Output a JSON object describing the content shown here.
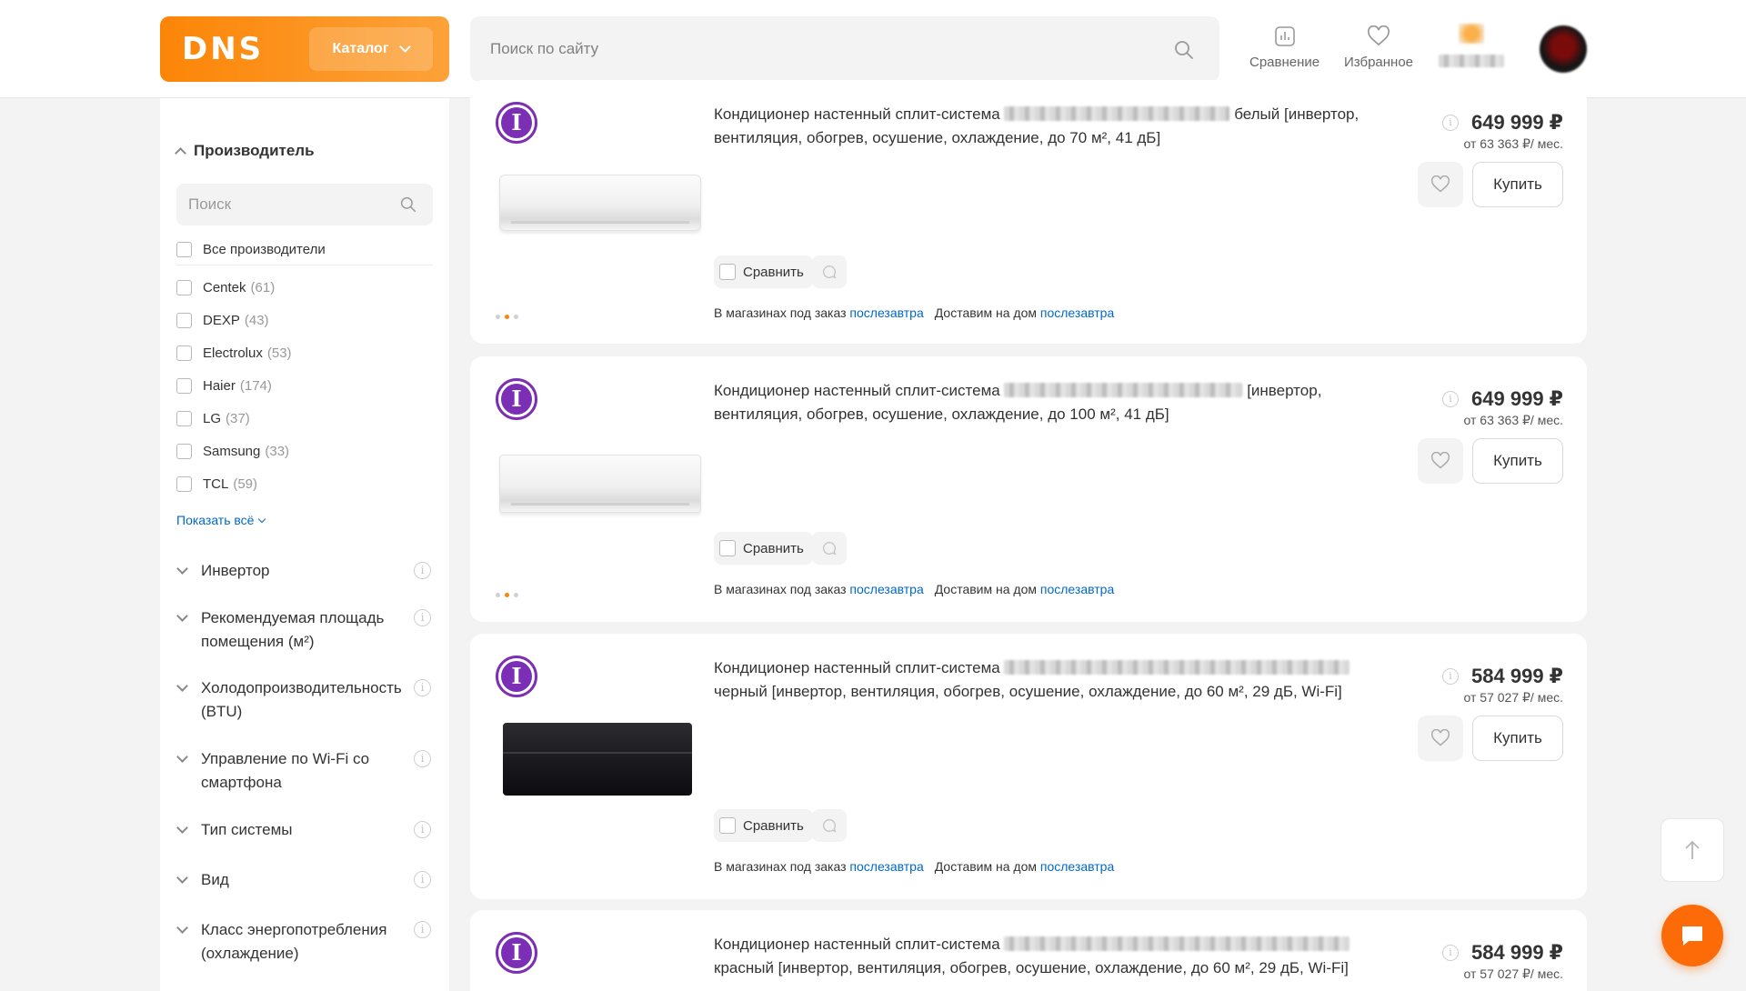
{
  "header": {
    "logo": "DNS",
    "catalog_label": "Каталог",
    "search_placeholder": "Поиск по сайту",
    "compare_label": "Сравнение",
    "favorites_label": "Избранное",
    "brand_color": "#fc8507"
  },
  "filters": {
    "manufacturer": {
      "title": "Производитель",
      "search_placeholder": "Поиск",
      "all_label": "Все производители",
      "items": [
        {
          "name": "Centek",
          "count": "(61)"
        },
        {
          "name": "DEXP",
          "count": "(43)"
        },
        {
          "name": "Electrolux",
          "count": "(53)"
        },
        {
          "name": "Haier",
          "count": "(174)"
        },
        {
          "name": "LG",
          "count": "(37)"
        },
        {
          "name": "Samsung",
          "count": "(33)"
        },
        {
          "name": "TCL",
          "count": "(59)"
        }
      ],
      "show_all": "Показать всё"
    },
    "sections": [
      "Инвертор",
      "Рекомендуемая площадь помещения (м²)",
      "Холодопроизводительность (BTU)",
      "Управление по Wi-Fi со смартфона",
      "Тип системы",
      "Вид",
      "Класс энергопотребления (охлаждение)"
    ]
  },
  "products": [
    {
      "badge": "I",
      "title_prefix": "Кондиционер настенный сплит-система",
      "title_after_blur": "белый [инвертор,",
      "title_line2": "вентиляция, обогрев, осушение, охлаждение, до 70 м², 41 дБ]",
      "price": "649 999 ₽",
      "credit": "от 63 363 ₽/ мес.",
      "compare": "Сравнить",
      "buy": "Купить",
      "avail_store": "В магазинах под заказ",
      "avail_store_date": "послезавтра",
      "avail_delivery": "Доставим на дом",
      "avail_delivery_date": "послезавтра",
      "unit_color": "white"
    },
    {
      "badge": "I",
      "title_prefix": "Кондиционер настенный сплит-система",
      "title_after_blur": "[инвертор,",
      "title_line2": "вентиляция, обогрев, осушение, охлаждение, до 100 м², 41 дБ]",
      "price": "649 999 ₽",
      "credit": "от 63 363 ₽/ мес.",
      "compare": "Сравнить",
      "buy": "Купить",
      "avail_store": "В магазинах под заказ",
      "avail_store_date": "послезавтра",
      "avail_delivery": "Доставим на дом",
      "avail_delivery_date": "послезавтра",
      "unit_color": "white"
    },
    {
      "badge": "I",
      "title_prefix": "Кондиционер настенный сплит-система",
      "title_after_blur": "",
      "title_line2": "черный [инвертор, вентиляция, обогрев, осушение, охлаждение, до 60 м², 29 дБ, Wi-Fi]",
      "price": "584 999 ₽",
      "credit": "от 57 027 ₽/ мес.",
      "compare": "Сравнить",
      "buy": "Купить",
      "avail_store": "В магазинах под заказ",
      "avail_store_date": "послезавтра",
      "avail_delivery": "Доставим на дом",
      "avail_delivery_date": "послезавтра",
      "unit_color": "black"
    },
    {
      "badge": "I",
      "title_prefix": "Кондиционер настенный сплит-система",
      "title_after_blur": "",
      "title_line2": "красный [инвертор, вентиляция, обогрев, осушение, охлаждение, до 60 м², 29 дБ, Wi-Fi]",
      "price": "584 999 ₽",
      "credit": "от 57 027 ₽/ мес."
    }
  ],
  "link_color": "#0068c9",
  "badge_color": "#7b2fb5"
}
